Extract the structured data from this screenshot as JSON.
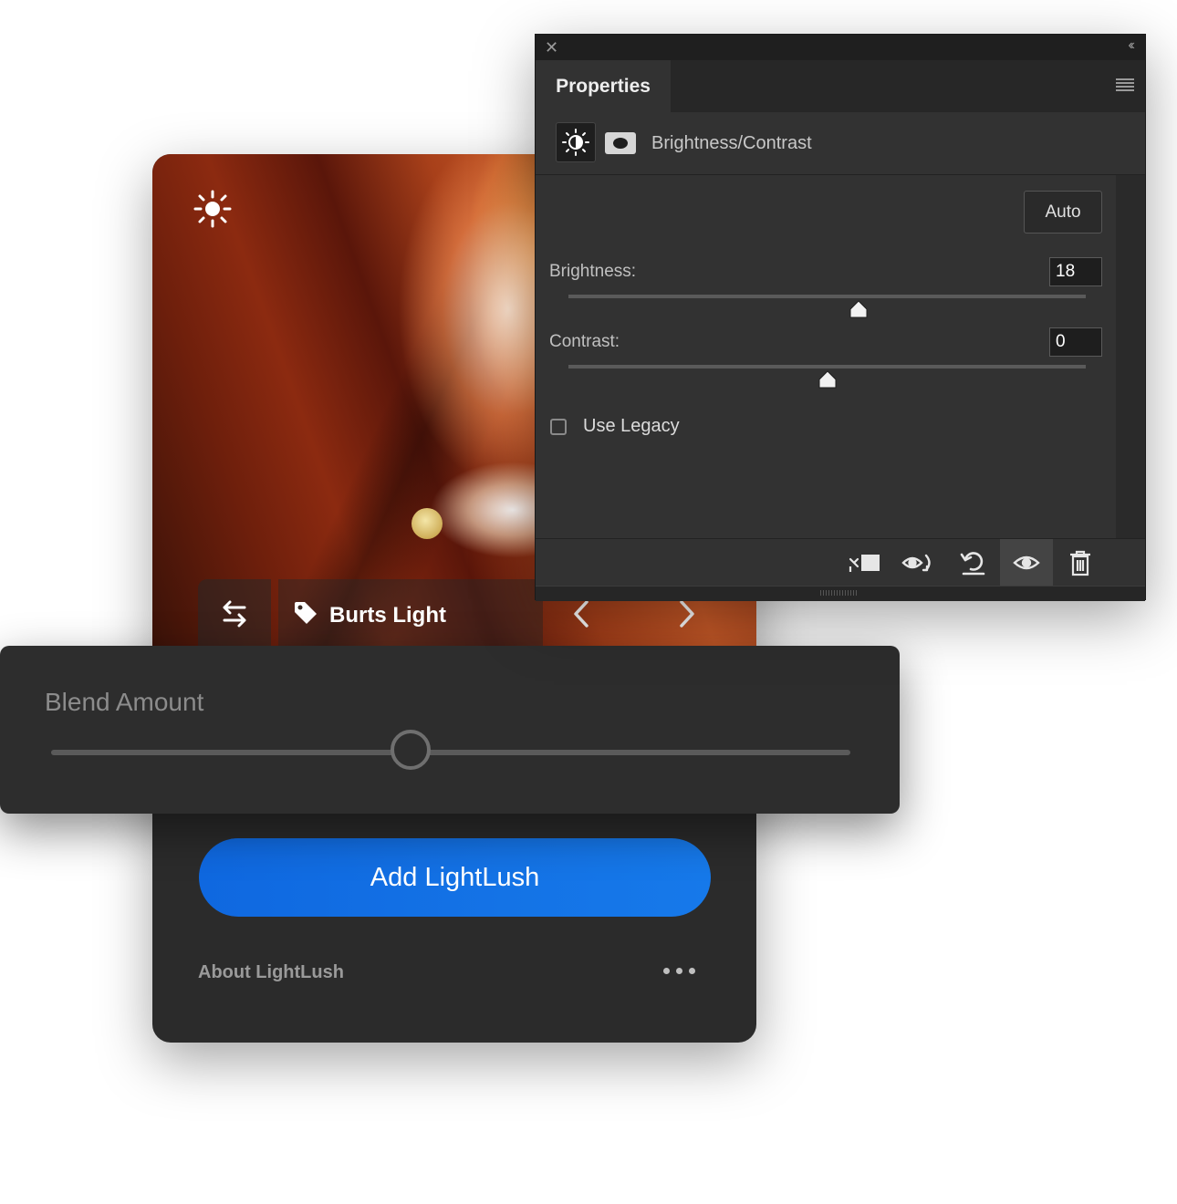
{
  "plugin_card": {
    "preset_name": "Burts Light",
    "add_button_label": "Add LightLush",
    "about_link": "About LightLush"
  },
  "blend": {
    "label": "Blend Amount",
    "value_fraction": 0.45
  },
  "properties": {
    "tab_title": "Properties",
    "adjustment_title": "Brightness/Contrast",
    "auto_label": "Auto",
    "brightness_label": "Brightness:",
    "brightness_value": "18",
    "brightness_slider_fraction": 0.56,
    "contrast_label": "Contrast:",
    "contrast_value": "0",
    "contrast_slider_fraction": 0.5,
    "use_legacy_label": "Use Legacy",
    "use_legacy_checked": false,
    "footer_icons": [
      "clip-to-layer-icon",
      "view-previous-state-icon",
      "reset-icon",
      "toggle-visibility-icon",
      "delete-icon"
    ],
    "active_footer_icon": "toggle-visibility-icon"
  },
  "colors": {
    "accent_blue": "#1473e6",
    "panel_bg": "#323232",
    "card_bg": "#2b2b2b"
  }
}
